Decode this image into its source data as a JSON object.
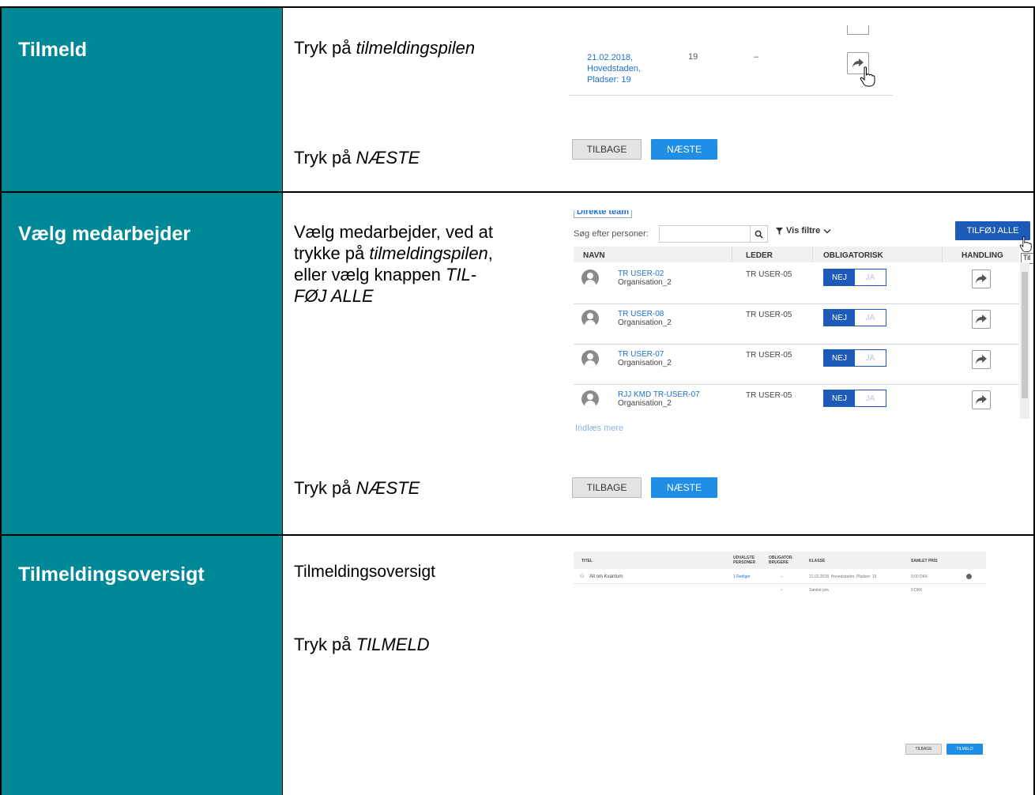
{
  "rows": [
    {
      "title": "Tilmeld",
      "instructions": [
        {
          "prefix": "Tryk på ",
          "emph": "tilmeldingspilen",
          "suffix": ""
        },
        {
          "prefix": "Tryk på ",
          "emph": "NÆSTE",
          "suffix": ""
        }
      ],
      "shot": {
        "entry_date_text": "21.02.2018,",
        "entry_region": "Hovedstaden,",
        "entry_seats": "Pladser: 19",
        "entry_count": "19",
        "entry_dash": "–",
        "back_label": "TILBAGE",
        "next_label": "NÆSTE"
      }
    },
    {
      "title": "Vælg medarbejder",
      "instruction_parts": {
        "line1": "Vælg medarbejder, ved at",
        "line2_prefix": "trykke på ",
        "line2_emph": "tilmeldingspilen",
        "line2_suffix": ",",
        "line3_prefix": "eller vælg knappen ",
        "line3_emph": "TIL-",
        "line4_emph": "FØJ ALLE"
      },
      "instruction2": {
        "prefix": "Tryk på ",
        "emph": "NÆSTE"
      },
      "shot": {
        "team_tab": "Direkte team",
        "search_label": "Søg efter personer:",
        "filter_label": "Vis filtre",
        "add_all_label": "TILFØJ ALLE",
        "tooltip": "Til",
        "headers": {
          "name": "NAVN",
          "leader": "LEDER",
          "mandatory": "OBLIGATORISK",
          "action": "HANDLING"
        },
        "people": [
          {
            "name": "TR USER-02",
            "org": "Organisation_2",
            "leader": "TR USER-05",
            "no": "NEJ",
            "yes": "JA"
          },
          {
            "name": "TR USER-08",
            "org": "Organisation_2",
            "leader": "TR USER-05",
            "no": "NEJ",
            "yes": "JA"
          },
          {
            "name": "TR USER-07",
            "org": "Organisation_2",
            "leader": "TR USER-05",
            "no": "NEJ",
            "yes": "JA"
          },
          {
            "name": "RJJ KMD TR-USER-07",
            "org": "Organisation_2",
            "leader": "TR USER-05",
            "no": "NEJ",
            "yes": "JA"
          }
        ],
        "load_more": "Indlæs mere",
        "back_label": "TILBAGE",
        "next_label": "NÆSTE"
      }
    },
    {
      "title": "Tilmeldingsoversigt",
      "instruction1": "Tilmeldingsoversigt",
      "instruction2": {
        "prefix": "Tryk på ",
        "emph": "TILMELD"
      },
      "shot": {
        "headers": {
          "title": "TITEL",
          "selected1": "UDVALGTE",
          "selected2": "PERSONER",
          "mandatory1": "OBLIGATOR.",
          "mandatory2": "BRUGERE",
          "class": "KLASSE",
          "total": "SAMLET PRIS"
        },
        "course": "Alt om Kvantum",
        "edit": "1 Rediger",
        "dash": "–",
        "class_text": "21.02.2018, Hovedstaden, Pladser: 19",
        "price": "0,00 DKK",
        "dash2": "–",
        "total_label": "Samlet pris",
        "total_value": "0 DKK",
        "back_label": "TILBAGE",
        "submit_label": "TILMELD"
      }
    }
  ]
}
